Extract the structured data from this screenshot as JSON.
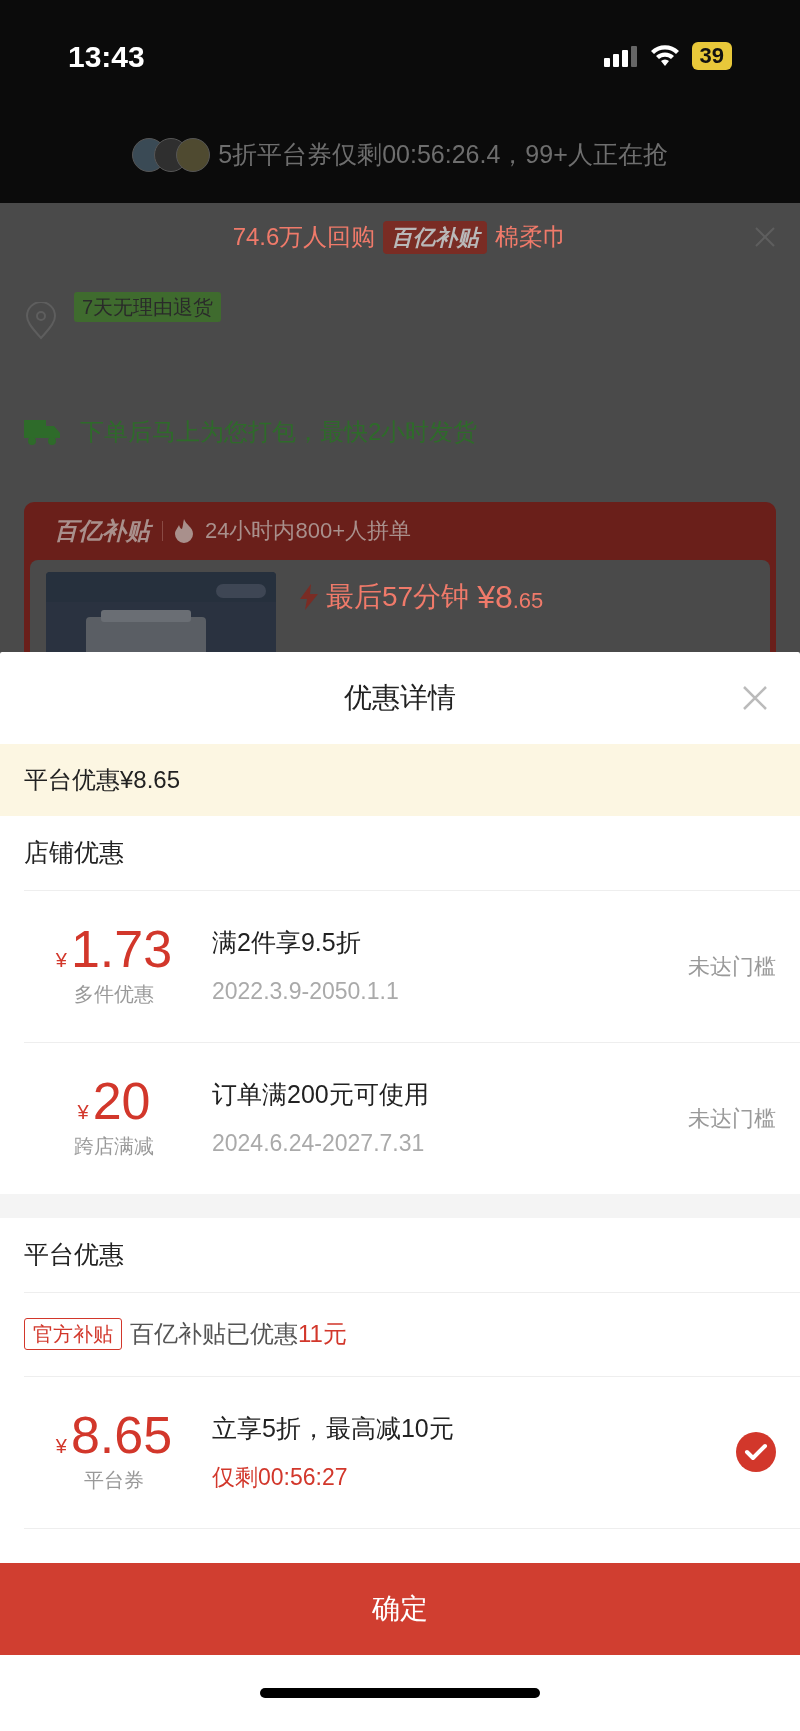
{
  "status_bar": {
    "time": "13:43",
    "battery": "39"
  },
  "background": {
    "notice": "5折平台券仅剩00:56:26.4，99+人正在抢",
    "promo": {
      "buyers": "74.6万人回购",
      "badge": "百亿补贴",
      "product": "棉柔巾"
    },
    "return_tag": "7天无理由退货",
    "shipping": "下单后马上为您打包，最快2小时发货",
    "subsidy_card": {
      "badge": "百亿补贴",
      "pledge": "24小时内800+人拼单",
      "deal": "最后57分钟",
      "price_int": "¥8",
      "price_dec": ".65"
    }
  },
  "sheet": {
    "title": "优惠详情",
    "platform_total": "平台优惠¥8.65",
    "sections": [
      {
        "title": "店铺优惠",
        "coupons": [
          {
            "currency": "¥",
            "amount": "1.73",
            "name": "多件优惠",
            "rule": "满2件享9.5折",
            "detail": "2022.3.9-2050.1.1",
            "urgent": false,
            "status": "未达门槛"
          },
          {
            "currency": "¥",
            "amount": "20",
            "name": "跨店满减",
            "rule": "订单满200元可使用",
            "detail": "2024.6.24-2027.7.31",
            "urgent": false,
            "status": "未达门槛"
          }
        ]
      },
      {
        "title": "平台优惠",
        "subsidy": {
          "tag": "官方补贴",
          "text": "百亿补贴已优惠",
          "amount": "11元"
        },
        "coupons": [
          {
            "currency": "¥",
            "amount": "8.65",
            "name": "平台券",
            "rule": "立享5折，最高减10元",
            "detail": "仅剩00:56:27",
            "urgent": true,
            "selected": true
          }
        ]
      }
    ]
  },
  "confirm": "确定"
}
